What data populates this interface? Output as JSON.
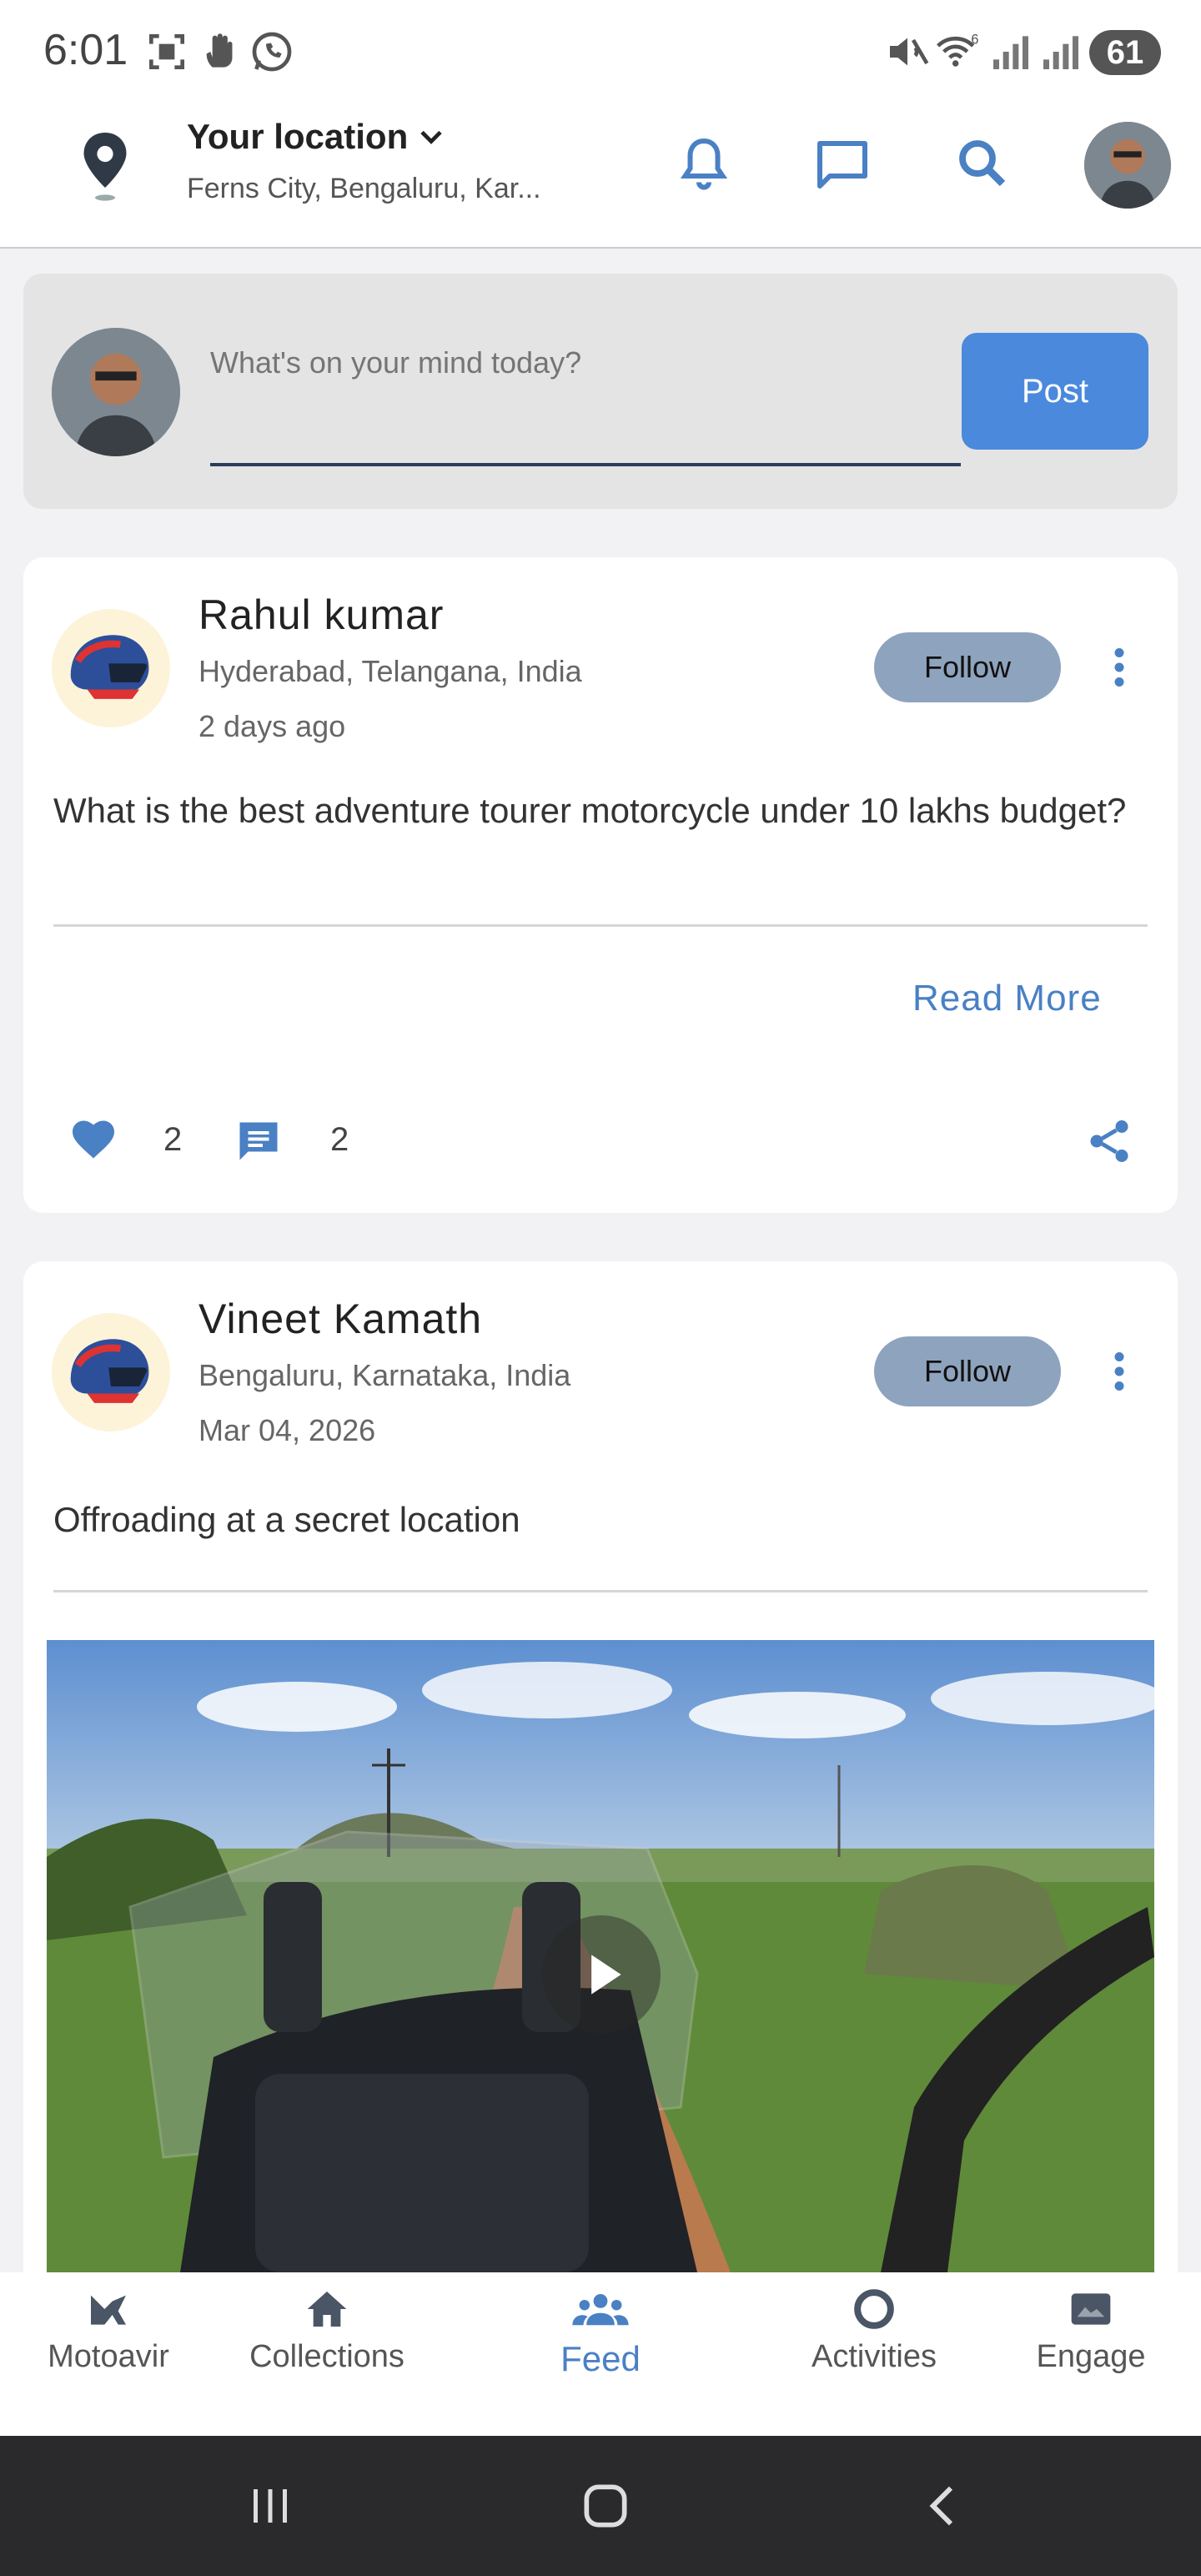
{
  "status_bar": {
    "time": "6:01",
    "battery": "61",
    "icons": [
      "screenshot-icon",
      "hand-icon",
      "whatsapp-icon",
      "mute-icon",
      "wifi-icon",
      "signal-icon",
      "signal-icon"
    ]
  },
  "header": {
    "location_title": "Your location",
    "location_sub": "Ferns City, Bengaluru, Kar...",
    "icons": [
      "map-pin-icon",
      "bell-icon",
      "chat-icon",
      "search-icon",
      "profile-avatar"
    ]
  },
  "composer": {
    "placeholder": "What's on your mind today?",
    "post_label": "Post"
  },
  "posts": [
    {
      "name": "Rahul kumar",
      "location": "Hyderabad, Telangana, India",
      "time": "2 days ago",
      "follow_label": "Follow",
      "text": "What is the best adventure tourer motorcycle under 10 lakhs budget?",
      "read_more": "Read More",
      "likes": "2",
      "comments": "2"
    },
    {
      "name": "Vineet Kamath",
      "location": "Bengaluru, Karnataka, India",
      "time": "Mar 04, 2026",
      "follow_label": "Follow",
      "text": "Offroading at a secret location"
    }
  ],
  "bottom_nav": {
    "items": [
      {
        "label": "Motoavir",
        "icon": "motoavir-logo-icon"
      },
      {
        "label": "Collections",
        "icon": "home-icon"
      },
      {
        "label": "Feed",
        "icon": "people-icon",
        "active": true
      },
      {
        "label": "Activities",
        "icon": "circle-icon"
      },
      {
        "label": "Engage",
        "icon": "image-icon"
      }
    ]
  },
  "colors": {
    "accent": "#4a89dc",
    "follow_bg": "#8ea3bd",
    "composer_bg": "#e4e4e5",
    "system_nav_bg": "#2a2a2c"
  }
}
